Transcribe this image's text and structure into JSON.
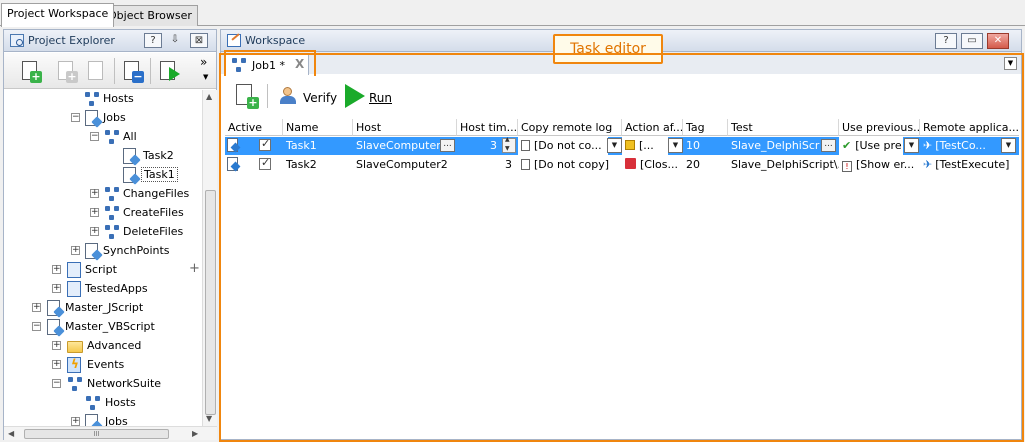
{
  "top_tabs": [
    "Project Workspace",
    "Object Browser"
  ],
  "explorer": {
    "title": "Project Explorer",
    "buttons": {
      "help": "?",
      "pin": "⇩",
      "close": "⊠"
    },
    "overflow": "»",
    "tree": [
      {
        "label": "Hosts",
        "icon": "network-icon"
      },
      {
        "label": "Jobs",
        "icon": "jobs-icon"
      },
      {
        "label": "All",
        "icon": "network-icon"
      },
      {
        "label": "Task2",
        "icon": "task-icon"
      },
      {
        "label": "Task1",
        "icon": "task-icon"
      },
      {
        "label": "ChangeFiles",
        "icon": "network-icon"
      },
      {
        "label": "CreateFiles",
        "icon": "network-icon"
      },
      {
        "label": "DeleteFiles",
        "icon": "network-icon"
      },
      {
        "label": "SynchPoints",
        "icon": "sync-icon"
      },
      {
        "label": "Script",
        "icon": "script-icon"
      },
      {
        "label": "TestedApps",
        "icon": "apps-icon"
      },
      {
        "label": "Master_JScript",
        "icon": "project-icon"
      },
      {
        "label": "Master_VBScript",
        "icon": "project-icon"
      },
      {
        "label": "Advanced",
        "icon": "folder-icon"
      },
      {
        "label": "Events",
        "icon": "events-icon"
      },
      {
        "label": "NetworkSuite",
        "icon": "network-icon"
      },
      {
        "label": "Hosts",
        "icon": "network-icon"
      },
      {
        "label": "Jobs",
        "icon": "jobs-icon"
      }
    ],
    "add_symbol": "+",
    "hscroll_grip": "III"
  },
  "workspace": {
    "title": "Workspace",
    "buttons": {
      "help": "?",
      "restore": "▭",
      "close": "✕"
    },
    "tab": {
      "label": "Job1 *",
      "close": "X"
    },
    "callout": "Task editor",
    "toolbar": {
      "verify": "Verify",
      "run": "Run"
    },
    "grid": {
      "columns": [
        "Active",
        "Name",
        "Host",
        "Host tim...",
        "Copy remote log",
        "Action af...",
        "Tag",
        "Test",
        "Use previous...",
        "Remote applica..."
      ],
      "rows": [
        {
          "name": "Task1",
          "host": "SlaveComputer1",
          "host_time": "3",
          "copy_log": "[Do not co...",
          "action": "[...",
          "tag": "10",
          "test": "Slave_DelphiScri...",
          "use_prev": "[Use pre",
          "remote_app": "[TestCo...",
          "selected": true
        },
        {
          "name": "Task2",
          "host": "SlaveComputer2",
          "host_time": "3",
          "copy_log": "[Do not copy]",
          "action": "[Clos...",
          "tag": "20",
          "test": "Slave_DelphiScript\\...",
          "use_prev": "[Show er...",
          "remote_app": "[TestExecute]",
          "selected": false
        }
      ]
    }
  },
  "colors": {
    "accent": "#f0860e",
    "selection": "#3399ff",
    "run": "#1aaa2a"
  }
}
